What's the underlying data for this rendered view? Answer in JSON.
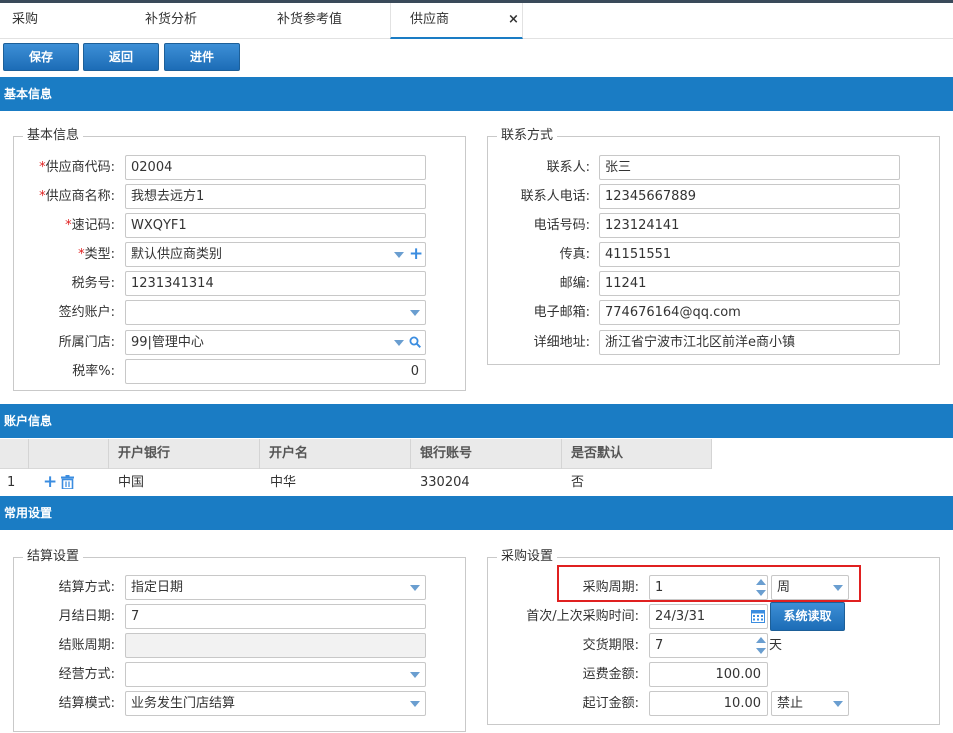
{
  "tabs": [
    "采购",
    "补货分析",
    "补货参考值",
    "供应商"
  ],
  "tab_close": "×",
  "toolbar": {
    "save": "保存",
    "back": "返回",
    "stock": "进件"
  },
  "sections": {
    "basic": "基本信息",
    "account": "账户信息",
    "common": "常用设置"
  },
  "basic_fieldset": {
    "legend": "基本信息",
    "fields": [
      {
        "label": "供应商代码:",
        "required": true,
        "value": "02004"
      },
      {
        "label": "供应商名称:",
        "required": true,
        "value": "我想去远方1"
      },
      {
        "label": "速记码:",
        "required": true,
        "value": "WXQYF1"
      },
      {
        "label": "类型:",
        "required": true,
        "value": "默认供应商类别"
      },
      {
        "label": "税务号:",
        "required": false,
        "value": "1231341314"
      },
      {
        "label": "签约账户:",
        "required": false,
        "value": ""
      },
      {
        "label": "所属门店:",
        "required": false,
        "value": "99|管理中心"
      },
      {
        "label": "税率%:",
        "required": false,
        "value": "0"
      }
    ]
  },
  "contact_fieldset": {
    "legend": "联系方式",
    "fields": [
      {
        "label": "联系人:",
        "value": "张三"
      },
      {
        "label": "联系人电话:",
        "value": "12345667889"
      },
      {
        "label": "电话号码:",
        "value": "123124141"
      },
      {
        "label": "传真:",
        "value": "41151551"
      },
      {
        "label": "邮编:",
        "value": "11241"
      },
      {
        "label": "电子邮箱:",
        "value": "774676164@qq.com"
      },
      {
        "label": "详细地址:",
        "value": "浙江省宁波市江北区前洋e商小镇"
      }
    ]
  },
  "bank_table": {
    "columns": [
      "开户银行",
      "开户名",
      "银行账号",
      "是否默认"
    ],
    "rows": [
      {
        "index": "1",
        "bank": "中国",
        "name": "中华",
        "account": "330204",
        "default": "否"
      }
    ]
  },
  "settle_fieldset": {
    "legend": "结算设置",
    "fields": [
      {
        "label": "结算方式:",
        "value": "指定日期"
      },
      {
        "label": "月结日期:",
        "value": "7"
      },
      {
        "label": "结账周期:",
        "value": ""
      },
      {
        "label": "经营方式:",
        "value": ""
      },
      {
        "label": "结算模式:",
        "value": "业务发生门店结算"
      }
    ]
  },
  "purchase_fieldset": {
    "legend": "采购设置",
    "cycle_label": "采购周期:",
    "cycle_value": "1",
    "cycle_unit": "周",
    "first_last_label": "首次/上次采购时间:",
    "first_last_value": "24/3/31",
    "system_read_button": "系统读取",
    "delivery_label": "交货期限:",
    "delivery_value": "7",
    "delivery_unit": "天",
    "freight_label": "运费金额:",
    "freight_value": "100.00",
    "min_order_label": "起订金额:",
    "min_order_value": "10.00",
    "min_order_mode": "禁止"
  },
  "colors": {
    "accent": "#1a7cc4",
    "required": "#e02020",
    "highlight": "#e02020"
  }
}
